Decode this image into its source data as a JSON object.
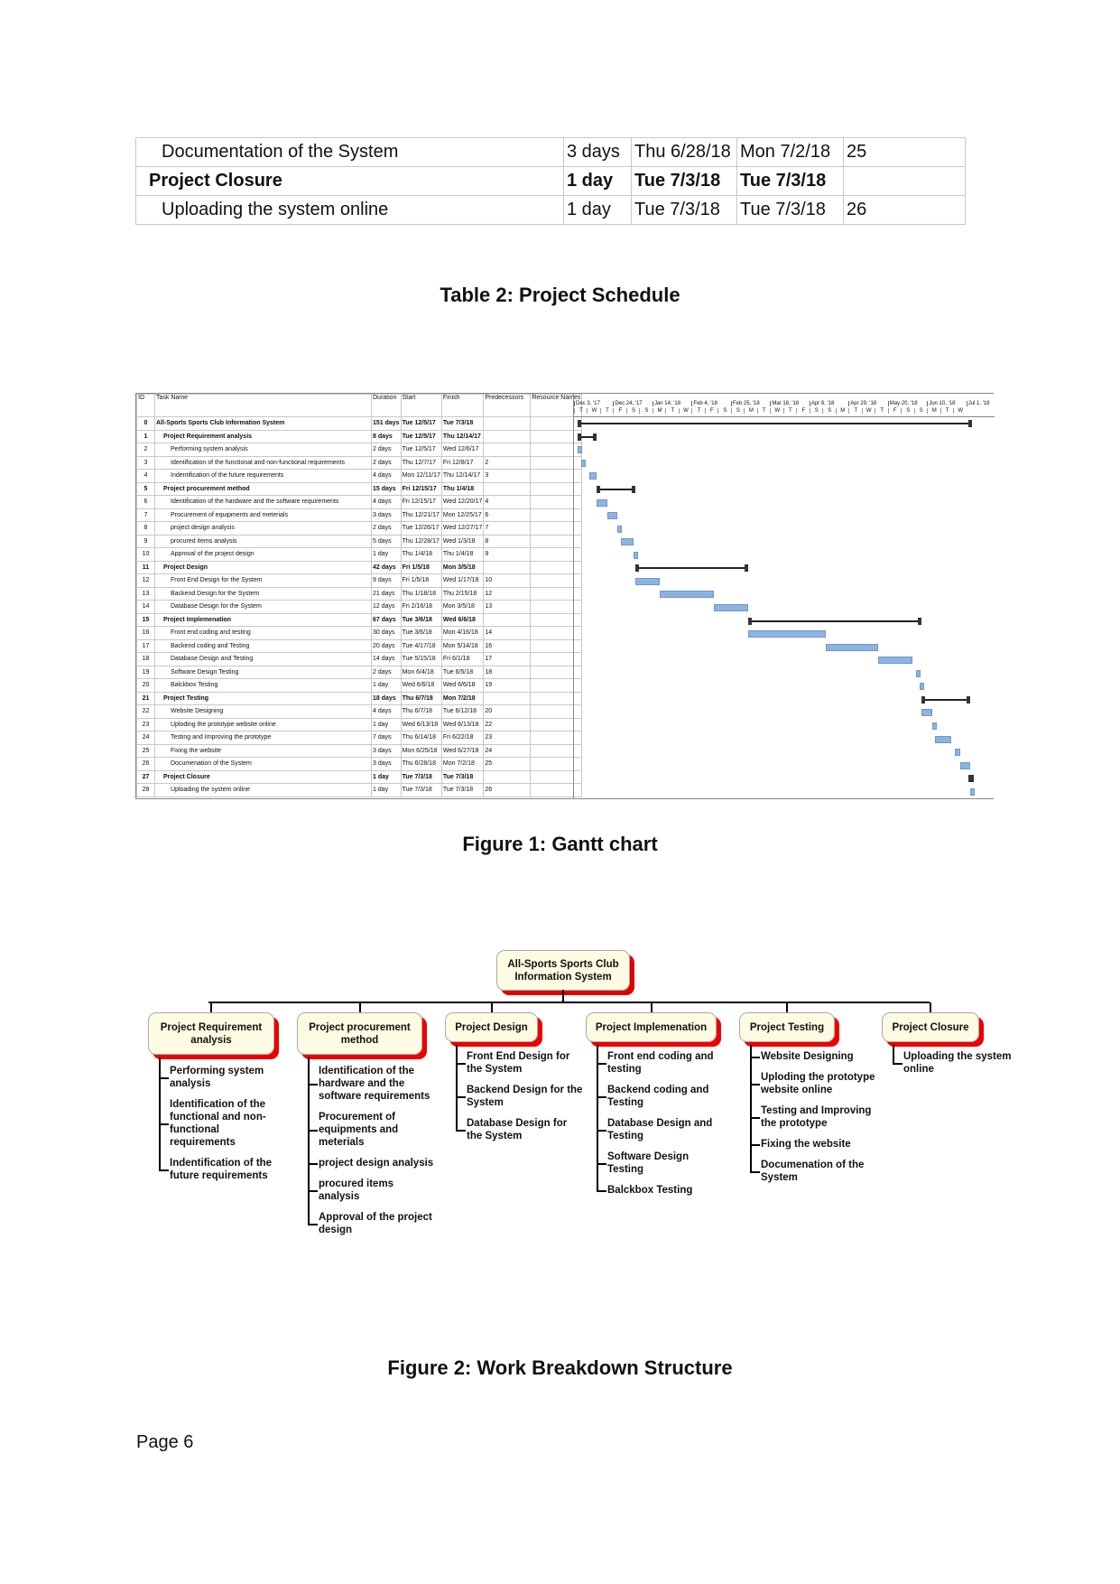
{
  "top_table": [
    {
      "task": "Documentation of the System",
      "duration": "3 days",
      "start": "Thu 6/28/18",
      "finish": "Mon 7/2/18",
      "pred": "25",
      "bold": false
    },
    {
      "task": "Project Closure",
      "duration": "1 day",
      "start": "Tue 7/3/18",
      "finish": "Tue 7/3/18",
      "pred": "",
      "bold": true
    },
    {
      "task": "Uploading the system online",
      "duration": "1 day",
      "start": "Tue 7/3/18",
      "finish": "Tue 7/3/18",
      "pred": "26",
      "bold": false
    }
  ],
  "table_caption": "Table 2: Project Schedule",
  "gantt": {
    "headers": {
      "id": "ID",
      "task": "Task Name",
      "duration": "Duration",
      "start": "Start",
      "finish": "Finish",
      "pred": "Predecessors",
      "resource": "Resource Names"
    },
    "timescale_major": [
      "Dec 3, '17",
      "Dec 24, '17",
      "Jan 14, '18",
      "Feb 4, '18",
      "Feb 25, '18",
      "Mar 18, '18",
      "Apr 8, '18",
      "Apr 29, '18",
      "May 20, '18",
      "Jun 10, '18",
      "Jul 1, '18"
    ],
    "timescale_minor": [
      "T",
      "W",
      "T",
      "F",
      "S",
      "S",
      "M",
      "T",
      "W",
      "T",
      "F",
      "S",
      "S",
      "M",
      "T",
      "W",
      "T",
      "F",
      "S",
      "S",
      "M",
      "T",
      "W",
      "T",
      "F",
      "S",
      "S",
      "M",
      "T",
      "W"
    ],
    "bar_color": "#8db3e2",
    "rows": [
      {
        "id": "0",
        "name": "All-Sports Sports Club Information System",
        "duration": "151 days",
        "start": "Tue 12/5/17",
        "finish": "Tue 7/3/18",
        "pred": "",
        "level": 0,
        "summary": true
      },
      {
        "id": "1",
        "name": "Project Requirement analysis",
        "duration": "8 days",
        "start": "Tue 12/5/17",
        "finish": "Thu 12/14/17",
        "pred": "",
        "level": 1,
        "summary": true
      },
      {
        "id": "2",
        "name": "Performing system analysis",
        "duration": "2 days",
        "start": "Tue 12/5/17",
        "finish": "Wed 12/6/17",
        "pred": "",
        "level": 2,
        "summary": false
      },
      {
        "id": "3",
        "name": "Identification of the functional and non-functional requirements",
        "duration": "2 days",
        "start": "Thu 12/7/17",
        "finish": "Fri 12/8/17",
        "pred": "2",
        "level": 2,
        "summary": false
      },
      {
        "id": "4",
        "name": "Indentification of the future requirements",
        "duration": "4 days",
        "start": "Mon 12/11/17",
        "finish": "Thu 12/14/17",
        "pred": "3",
        "level": 2,
        "summary": false
      },
      {
        "id": "5",
        "name": "Project procurement method",
        "duration": "15 days",
        "start": "Fri 12/15/17",
        "finish": "Thu 1/4/18",
        "pred": "",
        "level": 1,
        "summary": true
      },
      {
        "id": "6",
        "name": "Identification of the hardware and the software requirements",
        "duration": "4 days",
        "start": "Fri 12/15/17",
        "finish": "Wed 12/20/17",
        "pred": "4",
        "level": 2,
        "summary": false
      },
      {
        "id": "7",
        "name": "Procurement of equipments and meterials",
        "duration": "3 days",
        "start": "Thu 12/21/17",
        "finish": "Mon 12/25/17",
        "pred": "6",
        "level": 2,
        "summary": false
      },
      {
        "id": "8",
        "name": "project design analysis",
        "duration": "2 days",
        "start": "Tue 12/26/17",
        "finish": "Wed 12/27/17",
        "pred": "7",
        "level": 2,
        "summary": false
      },
      {
        "id": "9",
        "name": "procured items analysis",
        "duration": "5 days",
        "start": "Thu 12/28/17",
        "finish": "Wed 1/3/18",
        "pred": "8",
        "level": 2,
        "summary": false
      },
      {
        "id": "10",
        "name": "Approval of the project design",
        "duration": "1 day",
        "start": "Thu 1/4/18",
        "finish": "Thu 1/4/18",
        "pred": "9",
        "level": 2,
        "summary": false
      },
      {
        "id": "11",
        "name": "Project Design",
        "duration": "42 days",
        "start": "Fri 1/5/18",
        "finish": "Mon 3/5/18",
        "pred": "",
        "level": 1,
        "summary": true
      },
      {
        "id": "12",
        "name": "Front End Design for the System",
        "duration": "9 days",
        "start": "Fri 1/5/18",
        "finish": "Wed 1/17/18",
        "pred": "10",
        "level": 2,
        "summary": false
      },
      {
        "id": "13",
        "name": "Backend Design for the System",
        "duration": "21 days",
        "start": "Thu 1/18/18",
        "finish": "Thu 2/15/18",
        "pred": "12",
        "level": 2,
        "summary": false
      },
      {
        "id": "14",
        "name": "Database Design for the System",
        "duration": "12 days",
        "start": "Fri 2/16/18",
        "finish": "Mon 3/5/18",
        "pred": "13",
        "level": 2,
        "summary": false
      },
      {
        "id": "15",
        "name": "Project Implemenation",
        "duration": "67 days",
        "start": "Tue 3/6/18",
        "finish": "Wed 6/6/18",
        "pred": "",
        "level": 1,
        "summary": true
      },
      {
        "id": "16",
        "name": "Front end coding and testing",
        "duration": "30 days",
        "start": "Tue 3/6/18",
        "finish": "Mon 4/16/18",
        "pred": "14",
        "level": 2,
        "summary": false
      },
      {
        "id": "17",
        "name": "Backend coding and Testing",
        "duration": "20 days",
        "start": "Tue 4/17/18",
        "finish": "Mon 5/14/18",
        "pred": "16",
        "level": 2,
        "summary": false
      },
      {
        "id": "18",
        "name": "Database Design and Testing",
        "duration": "14 days",
        "start": "Tue 5/15/18",
        "finish": "Fri 6/1/18",
        "pred": "17",
        "level": 2,
        "summary": false
      },
      {
        "id": "19",
        "name": "Software Design Testing",
        "duration": "2 days",
        "start": "Mon 6/4/18",
        "finish": "Tue 6/5/18",
        "pred": "18",
        "level": 2,
        "summary": false
      },
      {
        "id": "20",
        "name": "Balckbox Testing",
        "duration": "1 day",
        "start": "Wed 6/6/18",
        "finish": "Wed 6/6/18",
        "pred": "19",
        "level": 2,
        "summary": false
      },
      {
        "id": "21",
        "name": "Project Testing",
        "duration": "18 days",
        "start": "Thu 6/7/18",
        "finish": "Mon 7/2/18",
        "pred": "",
        "level": 1,
        "summary": true
      },
      {
        "id": "22",
        "name": "Website Designing",
        "duration": "4 days",
        "start": "Thu 6/7/18",
        "finish": "Tue 6/12/18",
        "pred": "20",
        "level": 2,
        "summary": false
      },
      {
        "id": "23",
        "name": "Uploding the prototype website online",
        "duration": "1 day",
        "start": "Wed 6/13/18",
        "finish": "Wed 6/13/18",
        "pred": "22",
        "level": 2,
        "summary": false
      },
      {
        "id": "24",
        "name": "Testing and Improving the prototype",
        "duration": "7 days",
        "start": "Thu 6/14/18",
        "finish": "Fri 6/22/18",
        "pred": "23",
        "level": 2,
        "summary": false
      },
      {
        "id": "25",
        "name": "Fixing the website",
        "duration": "3 days",
        "start": "Mon 6/25/18",
        "finish": "Wed 6/27/18",
        "pred": "24",
        "level": 2,
        "summary": false
      },
      {
        "id": "26",
        "name": "Documenation of the System",
        "duration": "3 days",
        "start": "Thu 6/28/18",
        "finish": "Mon 7/2/18",
        "pred": "25",
        "level": 2,
        "summary": false
      },
      {
        "id": "27",
        "name": "Project Closure",
        "duration": "1 day",
        "start": "Tue 7/3/18",
        "finish": "Tue 7/3/18",
        "pred": "",
        "level": 1,
        "summary": true
      },
      {
        "id": "28",
        "name": "Uploading the system online",
        "duration": "1 day",
        "start": "Tue 7/3/18",
        "finish": "Tue 7/3/18",
        "pred": "26",
        "level": 2,
        "summary": false
      }
    ]
  },
  "figure1_caption": "Figure 1: Gantt chart",
  "wbs": {
    "root": "All-Sports Sports Club Information System",
    "shadow_color": "#e00000",
    "box_color": "#fdfbe2",
    "branches": [
      {
        "label": "Project Requirement analysis",
        "children": [
          "Performing system analysis",
          "Identification of the functional and non-functional requirements",
          "Indentification of the future requirements"
        ]
      },
      {
        "label": "Project procurement method",
        "children": [
          "Identification of the hardware and the software requirements",
          "Procurement of equipments and meterials",
          "project design analysis",
          "procured items analysis",
          "Approval of the project design"
        ]
      },
      {
        "label": "Project Design",
        "children": [
          "Front End Design for the System",
          "Backend Design for the System",
          "Database Design for the System"
        ]
      },
      {
        "label": "Project Implemenation",
        "children": [
          "Front end coding and testing",
          "Backend coding and Testing",
          "Database Design and Testing",
          "Software Design Testing",
          "Balckbox Testing"
        ]
      },
      {
        "label": "Project Testing",
        "children": [
          "Website Designing",
          "Uploding the prototype website online",
          "Testing and Improving the prototype",
          "Fixing the website",
          "Documenation of the System"
        ]
      },
      {
        "label": "Project Closure",
        "children": [
          "Uploading the system online"
        ]
      }
    ]
  },
  "figure2_caption": "Figure 2: Work Breakdown Structure",
  "page_number": "Page 6"
}
